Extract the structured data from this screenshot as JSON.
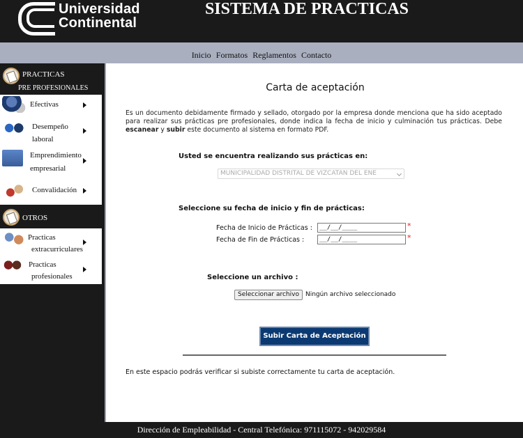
{
  "header": {
    "logo_line1": "Universidad",
    "logo_line2": "Continental",
    "title": "SISTEMA DE PRACTICAS"
  },
  "nav": {
    "items": [
      "Inicio",
      "Formatos",
      "Reglamentos",
      "Contacto"
    ]
  },
  "sidebar": {
    "practicas": {
      "title_line1": "PRACTICAS",
      "title_line2": "PRE PROFESIONALES",
      "items": [
        {
          "line1": "Efectivas",
          "line2": "",
          "icon": "graduate-icon"
        },
        {
          "line1": "Desempeño",
          "line2": "laboral",
          "icon": "handshake-icon"
        },
        {
          "line1": "Emprendimiento",
          "line2": "empresarial",
          "icon": "entrepreneur-icon"
        },
        {
          "line1": "Convalidación",
          "line2": "",
          "icon": "workers-icon"
        }
      ]
    },
    "otros": {
      "title": "OTROS",
      "items": [
        {
          "line1": "Practicas",
          "line2": "extracurriculares",
          "icon": "meeting-icon"
        },
        {
          "line1": "Practicas",
          "line2": "profesionales",
          "icon": "professionals-icon"
        }
      ]
    }
  },
  "main": {
    "title": "Carta de aceptación",
    "desc_part1": "Es un documento debidamente firmado y sellado, otorgado por la empresa donde menciona que ha sido aceptado para realizar sus prácticas pre profesionales, donde indica la fecha de inicio y culminación tus prácticas. Debe ",
    "desc_bold1": "escanear",
    "desc_part2": " y ",
    "desc_bold2": "subir",
    "desc_part3": " este documento al sistema en formato PDF.",
    "company_label": "Usted se encuentra realizando sus prácticas en:",
    "company_value": "MUNICIPALIDAD DISTRITAL DE VIZCATAN DEL ENE",
    "dates_label": "Seleccione su fecha de inicio y fin de prácticas:",
    "start_label": "Fecha de Inicio de Prácticas :",
    "end_label": "Fecha de Fin de Prácticas :",
    "date_placeholder": "__/__/____",
    "required_mark": "*",
    "file_label": "Seleccione un archivo :",
    "file_button": "Seleccionar archivo",
    "file_status": "Ningún archivo seleccionado",
    "upload_button": "Subir Carta de Aceptación",
    "verify_note": "En este espacio podrás verificar si subiste correctamente tu carta de aceptación."
  },
  "footer": {
    "text": "Dirección de Empleabilidad - Central Telefónica: 971115072 - 942029584"
  }
}
